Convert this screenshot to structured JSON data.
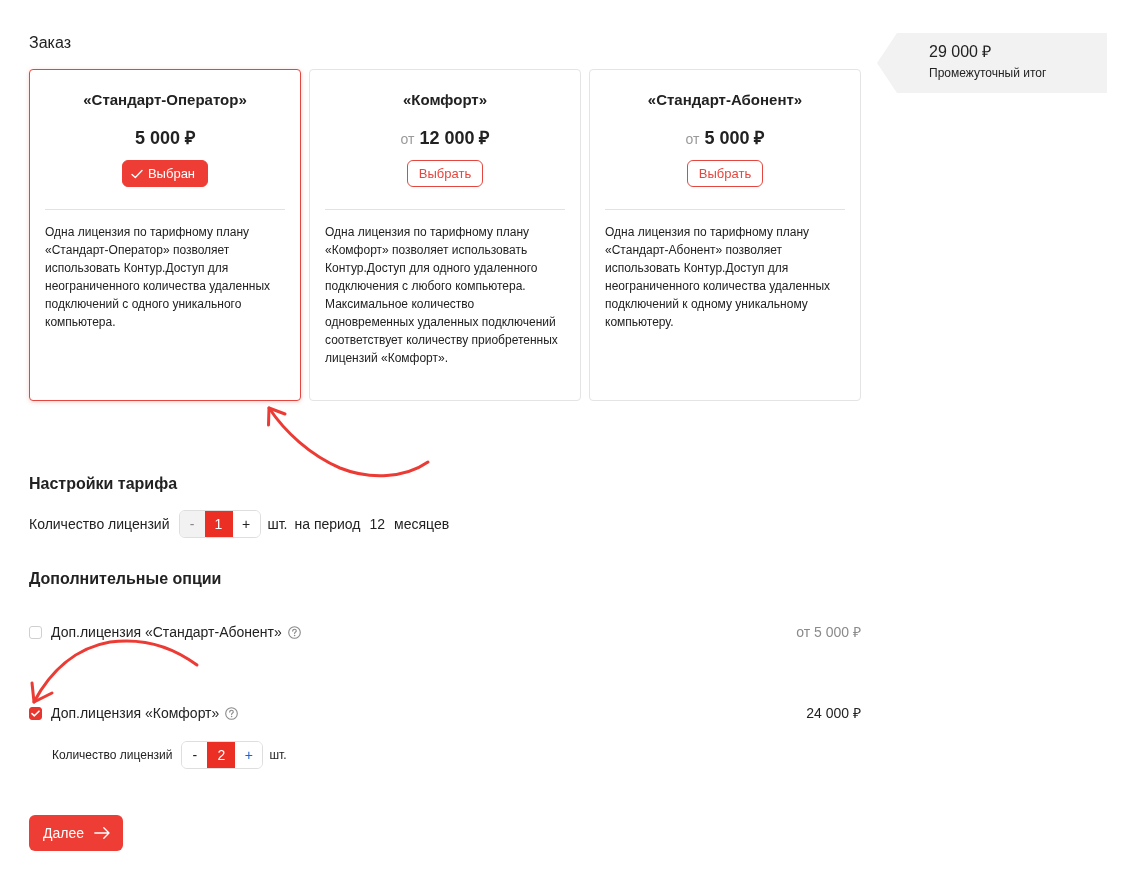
{
  "order": {
    "title": "Заказ",
    "plans": [
      {
        "name": "«Стандарт-Оператор»",
        "price": "5 000 ₽",
        "button": "Выбран",
        "selected": true,
        "description": "Одна лицензия по тарифному плану «Стандарт-Оператор» позволяет использовать Контур.Доступ для неограниченного количества удаленных подключений с одного уникального компьютера."
      },
      {
        "name": "«Комфорт»",
        "price_prefix": "от",
        "price": "12 000 ₽",
        "button": "Выбрать",
        "selected": false,
        "description": "Одна лицензия по тарифному плану «Комфорт» позволяет использовать Контур.Доступ для одного удаленного подключения с любого компьютера. Максимальное количество одновременных удаленных подключений соответствует количеству приобретенных лицензий «Комфорт»."
      },
      {
        "name": "«Стандарт-Абонент»",
        "price_prefix": "от",
        "price": "5 000 ₽",
        "button": "Выбрать",
        "selected": false,
        "description": "Одна лицензия по тарифному плану «Стандарт-Абонент» позволяет использовать Контур.Доступ для неограниченного количества удаленных подключений к одному уникальному компьютеру."
      }
    ]
  },
  "summary": {
    "total": "29 000 ₽",
    "label": "Промежуточный итог"
  },
  "tariff_settings": {
    "title": "Настройки тарифа",
    "quantity_label": "Количество лицензий",
    "stepper": {
      "minus": "-",
      "value": "1",
      "plus": "+",
      "minus_disabled": true
    },
    "unit": "шт.",
    "period_label": "на период",
    "period_value": "12",
    "period_unit": "месяцев"
  },
  "extra_options": {
    "title": "Дополнительные опции",
    "items": [
      {
        "label": "Доп.лицензия «Стандарт-Абонент»",
        "checked": false,
        "price": "от 5 000 ₽"
      },
      {
        "label": "Доп.лицензия «Комфорт»",
        "checked": true,
        "price": "24 000 ₽",
        "quantity": {
          "label": "Количество лицензий",
          "stepper": {
            "minus": "-",
            "value": "2",
            "plus": "+",
            "minus_disabled": false
          },
          "unit": "шт."
        }
      }
    ]
  },
  "next_button": {
    "label": "Далее"
  }
}
